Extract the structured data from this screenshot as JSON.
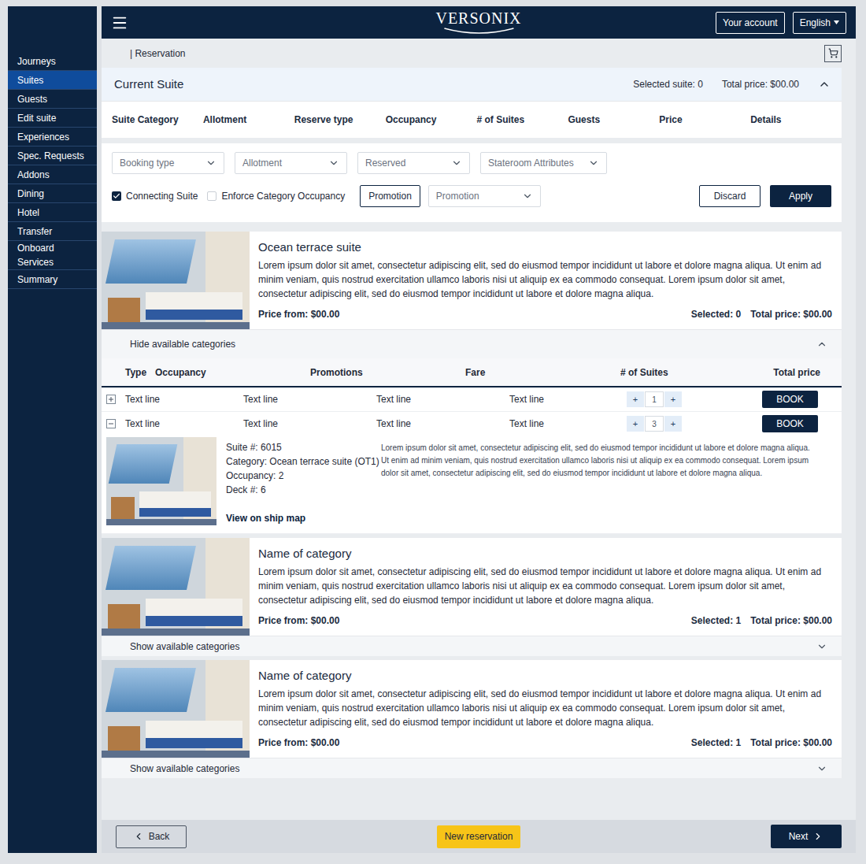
{
  "header": {
    "logo": "VERSONIX",
    "account_button": "Your account",
    "language": "English"
  },
  "sidebar": {
    "items": [
      {
        "label": "Journeys",
        "selected": false
      },
      {
        "label": "Suites",
        "selected": true
      },
      {
        "label": "Guests",
        "selected": false
      },
      {
        "label": "Edit suite",
        "selected": false
      },
      {
        "label": "Experiences",
        "selected": false
      },
      {
        "label": "Spec. Requests",
        "selected": false
      },
      {
        "label": "Addons",
        "selected": false
      },
      {
        "label": "Dining",
        "selected": false
      },
      {
        "label": "Hotel",
        "selected": false
      },
      {
        "label": "Transfer",
        "selected": false
      },
      {
        "label": "Onboard Services",
        "selected": false
      },
      {
        "label": "Summary",
        "selected": false
      }
    ]
  },
  "breadcrumb": "| Reservation",
  "current_suite": {
    "title": "Current Suite",
    "selected": "Selected suite: 0",
    "total": "Total price: $00.00",
    "expanded": true,
    "columns": [
      "Suite Category",
      "Allotment",
      "Reserve type",
      "Occupancy",
      "# of Suites",
      "Guests",
      "Price",
      "Details"
    ]
  },
  "filters": {
    "selects": [
      "Booking type",
      "Allotment",
      "Reserved",
      "Stateroom Attributes"
    ],
    "checkboxes": [
      {
        "label": "Connecting Suite",
        "checked": true
      },
      {
        "label": "Enforce Category Occupancy",
        "checked": false
      }
    ],
    "promotion_button": "Promotion",
    "promotion_select": "Promotion",
    "discard": "Discard",
    "apply": "Apply"
  },
  "categories": [
    {
      "title": "Ocean terrace suite",
      "description": "Lorem ipsum dolor sit amet, consectetur adipiscing elit, sed do eiusmod tempor incididunt ut labore et dolore magna aliqua. Ut enim ad minim veniam, quis nostrud exercitation ullamco laboris nisi ut aliquip ex ea commodo consequat. Lorem ipsum dolor sit amet, consectetur adipiscing elit, sed do eiusmod tempor incididunt ut labore et dolore magna aliqua.",
      "price": "Price from: $00.00",
      "selected": "Selected: 0",
      "total": "Total price: $00.00",
      "toggle": "Hide available categories",
      "expanded": true,
      "table": {
        "columns": [
          "Type",
          "Occupancy",
          "Promotions",
          "Fare",
          "# of Suites",
          "Total price"
        ],
        "rows": [
          {
            "cells": [
              "Text line",
              "Text line",
              "Text line",
              "Text line"
            ],
            "decrement": "+",
            "quantity": "1",
            "increment": "+",
            "book": "BOOK",
            "expanded": false
          },
          {
            "cells": [
              "Text line",
              "Text line",
              "Text line",
              "Text line"
            ],
            "decrement": "+",
            "quantity": "3",
            "increment": "+",
            "book": "BOOK",
            "expanded": true,
            "detail": {
              "lines": [
                "Suite #: 6015",
                "Category: Ocean terrace suite (OT1)",
                "Occupancy: 2",
                "Deck #: 6"
              ],
              "link": "View on ship map",
              "description": "Lorem ipsum dolor sit amet, consectetur adipiscing elit, sed do eiusmod tempor incididunt ut labore et dolore magna aliqua. Ut enim ad minim veniam, quis nostrud exercitation ullamco laboris nisi ut aliquip ex ea commodo consequat. Lorem ipsum dolor sit amet, consectetur adipiscing elit, sed do eiusmod tempor incididunt ut labore et dolore magna aliqua."
            }
          }
        ]
      }
    },
    {
      "title": "Name of category",
      "description": "Lorem ipsum dolor sit amet, consectetur adipiscing elit, sed do eiusmod tempor incididunt ut labore et dolore magna aliqua. Ut enim ad minim veniam, quis nostrud exercitation ullamco laboris nisi ut aliquip ex ea commodo consequat. Lorem ipsum dolor sit amet, consectetur adipiscing elit, sed do eiusmod tempor incididunt ut labore et dolore magna aliqua.",
      "price": "Price from: $00.00",
      "selected": "Selected: 1",
      "total": "Total price: $00.00",
      "toggle": "Show available categories",
      "expanded": false
    },
    {
      "title": "Name of category",
      "description": "Lorem ipsum dolor sit amet, consectetur adipiscing elit, sed do eiusmod tempor incididunt ut labore et dolore magna aliqua. Ut enim ad minim veniam, quis nostrud exercitation ullamco laboris nisi ut aliquip ex ea commodo consequat. Lorem ipsum dolor sit amet, consectetur adipiscing elit, sed do eiusmod tempor incididunt ut labore et dolore magna aliqua.",
      "price": "Price from: $00.00",
      "selected": "Selected: 1",
      "total": "Total price: $00.00",
      "toggle": "Show available categories",
      "expanded": false
    }
  ],
  "footer": {
    "back": "Back",
    "new_reservation": "New reservation",
    "next": "Next"
  }
}
